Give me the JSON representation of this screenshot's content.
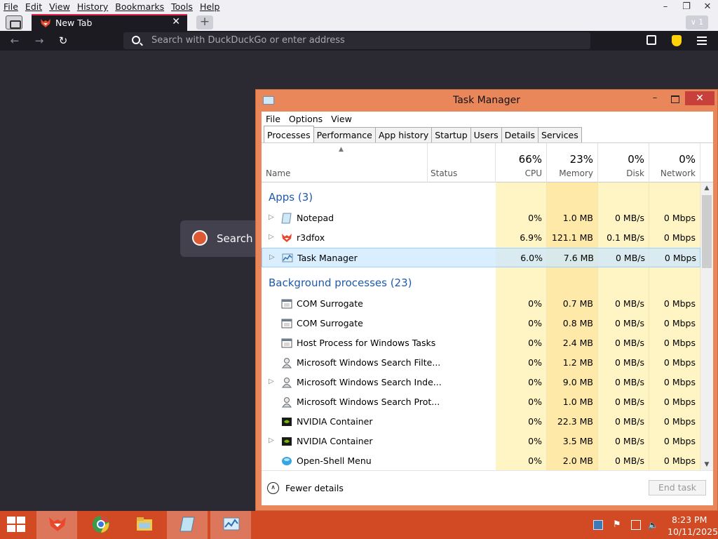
{
  "browser": {
    "menu": [
      "File",
      "Edit",
      "View",
      "History",
      "Bookmarks",
      "Tools",
      "Help"
    ],
    "window_controls": [
      "–",
      "❐",
      "✕"
    ],
    "tab": {
      "title": "New Tab",
      "close": "✕"
    },
    "new_tab_glyph": "+",
    "tab_count": "1",
    "tab_count_arrow": "∨",
    "nav": {
      "back": "←",
      "forward": "→",
      "reload": "↻"
    },
    "url_placeholder": "Search with DuckDuckGo or enter address",
    "search_box_text": "Search w",
    "icons": [
      "tab-list-icon",
      "extensions-icon",
      "shield-icon",
      "menu-icon"
    ]
  },
  "task_manager": {
    "title": "Task Manager",
    "window_controls": [
      "–",
      "☐",
      "✕"
    ],
    "menu": [
      "File",
      "Options",
      "View"
    ],
    "tabs": [
      "Processes",
      "Performance",
      "App history",
      "Startup",
      "Users",
      "Details",
      "Services"
    ],
    "active_tab": "Processes",
    "sort_arrow": "▲",
    "columns": {
      "name": "Name",
      "status": "Status",
      "cpu": {
        "pct": "66%",
        "label": "CPU"
      },
      "memory": {
        "pct": "23%",
        "label": "Memory"
      },
      "disk": {
        "pct": "0%",
        "label": "Disk"
      },
      "network": {
        "pct": "0%",
        "label": "Network"
      }
    },
    "groups": {
      "apps": "Apps (3)",
      "background": "Background processes (23)"
    },
    "apps": [
      {
        "name": "Notepad",
        "cpu": "0%",
        "memory": "1.0 MB",
        "disk": "0 MB/s",
        "network": "0 Mbps",
        "expandable": true,
        "icon": "notepad-icon"
      },
      {
        "name": "r3dfox",
        "cpu": "6.9%",
        "memory": "121.1 MB",
        "disk": "0.1 MB/s",
        "network": "0 Mbps",
        "expandable": true,
        "icon": "r3dfox-icon"
      },
      {
        "name": "Task Manager",
        "cpu": "6.0%",
        "memory": "7.6 MB",
        "disk": "0 MB/s",
        "network": "0 Mbps",
        "expandable": true,
        "selected": true,
        "icon": "task-manager-icon"
      }
    ],
    "background": [
      {
        "name": "COM Surrogate",
        "cpu": "0%",
        "memory": "0.7 MB",
        "disk": "0 MB/s",
        "network": "0 Mbps",
        "expandable": false,
        "icon": "window-app-icon"
      },
      {
        "name": "COM Surrogate",
        "cpu": "0%",
        "memory": "0.8 MB",
        "disk": "0 MB/s",
        "network": "0 Mbps",
        "expandable": false,
        "icon": "window-app-icon"
      },
      {
        "name": "Host Process for Windows Tasks",
        "cpu": "0%",
        "memory": "2.4 MB",
        "disk": "0 MB/s",
        "network": "0 Mbps",
        "expandable": false,
        "icon": "window-app-icon"
      },
      {
        "name": "Microsoft Windows Search Filte...",
        "cpu": "0%",
        "memory": "1.2 MB",
        "disk": "0 MB/s",
        "network": "0 Mbps",
        "expandable": false,
        "icon": "search-user-icon"
      },
      {
        "name": "Microsoft Windows Search Inde...",
        "cpu": "0%",
        "memory": "9.0 MB",
        "disk": "0 MB/s",
        "network": "0 Mbps",
        "expandable": true,
        "icon": "search-user-icon"
      },
      {
        "name": "Microsoft Windows Search Prot...",
        "cpu": "0%",
        "memory": "1.0 MB",
        "disk": "0 MB/s",
        "network": "0 Mbps",
        "expandable": false,
        "icon": "search-user-icon"
      },
      {
        "name": "NVIDIA Container",
        "cpu": "0%",
        "memory": "22.3 MB",
        "disk": "0 MB/s",
        "network": "0 Mbps",
        "expandable": false,
        "icon": "nvidia-icon"
      },
      {
        "name": "NVIDIA Container",
        "cpu": "0%",
        "memory": "3.5 MB",
        "disk": "0 MB/s",
        "network": "0 Mbps",
        "expandable": true,
        "icon": "nvidia-icon"
      },
      {
        "name": "Open-Shell Menu",
        "cpu": "0%",
        "memory": "2.0 MB",
        "disk": "0 MB/s",
        "network": "0 Mbps",
        "expandable": false,
        "icon": "open-shell-icon"
      }
    ],
    "expand_glyph": "▷",
    "scroll": {
      "up": "▲",
      "down": "▼"
    },
    "footer": {
      "fewer_glyph": "∧",
      "fewer_details": "Fewer details",
      "end_task": "End task"
    }
  },
  "taskbar": {
    "apps": [
      "r3dfox-icon",
      "chrome-icon",
      "file-explorer-icon",
      "notepad-icon",
      "task-manager-icon"
    ],
    "tray_icons": [
      "network-icon",
      "flag-icon",
      "monitor-icon",
      "volume-icon"
    ],
    "time": "8:23 PM",
    "date": "10/11/2025"
  },
  "colors": {
    "accent_tab": "#e22850",
    "tm_frame": "#e9865a",
    "taskbar": "#d24a24",
    "group_heading": "#1e5aa8",
    "heat_light": "#fff4c4",
    "heat_mem": "#ffe9a8"
  }
}
